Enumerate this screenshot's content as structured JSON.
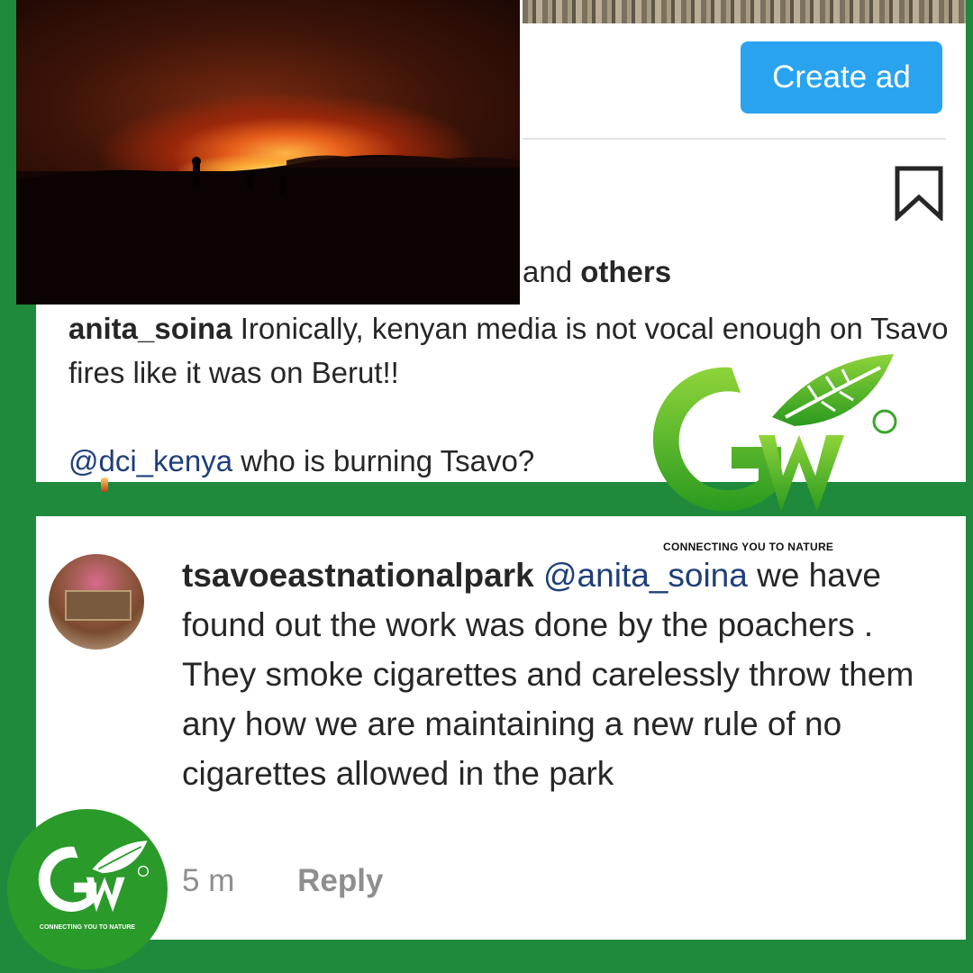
{
  "top_post": {
    "create_ad_label": "Create ad",
    "likes_prefix": "and ",
    "likes_others": "others",
    "comment": {
      "user": "anita_soina",
      "text_line1": " Ironically, kenyan media is not vocal enough on Tsavo fires like it was on Berut!!",
      "mention": "@dci_kenya",
      "text_line2": " who is burning Tsavo?"
    }
  },
  "reply": {
    "user": "tsavoeastnationalpark",
    "mention": "@anita_soina",
    "text": " we have found out the work was done by the poachers . They smoke cigarettes and carelessly throw them any how we are maintaining a new rule of no cigarettes allowed in the park",
    "time": "5 m",
    "reply_label": "Reply"
  },
  "watermark": {
    "tagline": "CONNECTING YOU TO NATURE"
  },
  "colors": {
    "background": "#1f8a3b",
    "button": "#2aa3ef",
    "mention": "#1f3f7a",
    "logo_green": "#3aa52a"
  }
}
